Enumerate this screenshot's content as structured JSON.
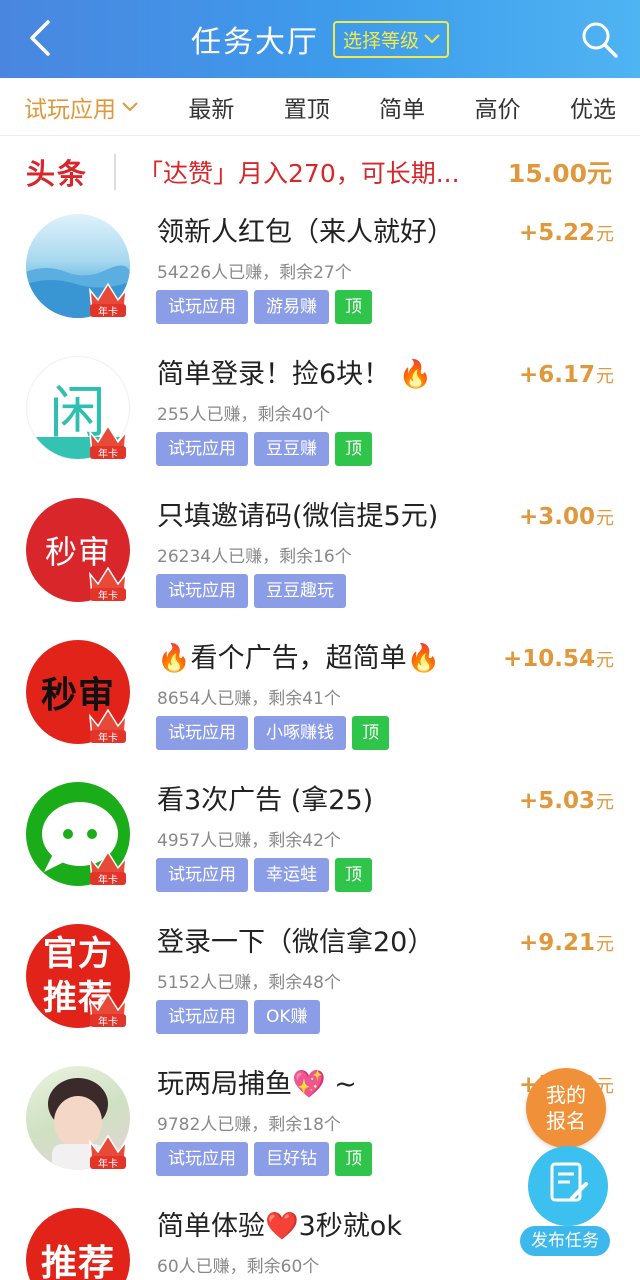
{
  "header": {
    "title": "任务大厅",
    "level_button": "选择等级",
    "back_icon": "chevron-left-icon",
    "search_icon": "search-icon"
  },
  "tabs": [
    {
      "label": "试玩应用",
      "active": true
    },
    {
      "label": "最新"
    },
    {
      "label": "置顶"
    },
    {
      "label": "简单"
    },
    {
      "label": "高价"
    },
    {
      "label": "优选"
    }
  ],
  "headline": {
    "tag": "头条",
    "text": "「达赞」月入270，可长期...",
    "price": "15.00元"
  },
  "tasks": [
    {
      "title": "领新人红包（来人就好）",
      "meta": "54226人已赚，剩余27个",
      "tags": [
        "试玩应用",
        "游易赚"
      ],
      "top": "顶",
      "price": "+5.22",
      "unit": "元",
      "badge": "年卡",
      "avatar_color": "#7fc4e6"
    },
    {
      "title": "简单登录！捡6块！ 🔥",
      "meta": "255人已赚，剩余40个",
      "tags": [
        "试玩应用",
        "豆豆赚"
      ],
      "top": "顶",
      "price": "+6.17",
      "unit": "元",
      "badge": "年卡",
      "avatar_text": "闲",
      "avatar_color": "#ffffff"
    },
    {
      "title": "只填邀请码(微信提5元)",
      "meta": "26234人已赚，剩余16个",
      "tags": [
        "试玩应用",
        "豆豆趣玩"
      ],
      "top": "",
      "price": "+3.00",
      "unit": "元",
      "badge": "年卡",
      "avatar_text": "秒审",
      "avatar_color": "#d8262b"
    },
    {
      "title": "🔥看个广告，超简单🔥",
      "meta": "8654人已赚，剩余41个",
      "tags": [
        "试玩应用",
        "小啄赚钱"
      ],
      "top": "顶",
      "price": "+10.54",
      "unit": "元",
      "badge": "年卡",
      "avatar_text": "秒审",
      "avatar_color": "#e2231a"
    },
    {
      "title": "看3次广告 (拿25)",
      "meta": "4957人已赚，剩余42个",
      "tags": [
        "试玩应用",
        "幸运蛙"
      ],
      "top": "顶",
      "price": "+5.03",
      "unit": "元",
      "badge": "年卡",
      "avatar_color": "#1aad19"
    },
    {
      "title": "登录一下（微信拿20）",
      "meta": "5152人已赚，剩余48个",
      "tags": [
        "试玩应用",
        "OK赚"
      ],
      "top": "",
      "price": "+9.21",
      "unit": "元",
      "badge": "年卡",
      "avatar_text": "官方推荐",
      "avatar_color": "#e2231a"
    },
    {
      "title": "玩两局捕鱼💖 ~",
      "meta": "9782人已赚，剩余18个",
      "tags": [
        "试玩应用",
        "巨好钻"
      ],
      "top": "顶",
      "price": "+5.00",
      "unit": "元",
      "badge": "年卡",
      "avatar_color": "#d9e8d0"
    },
    {
      "title": "简单体验❤️3秒就ok",
      "meta": "60人已赚，剩余60个",
      "tags": [],
      "top": "",
      "price": "",
      "unit": "",
      "badge": "",
      "avatar_text": "推荐",
      "avatar_color": "#e2231a"
    }
  ],
  "fab": {
    "signup_line1": "我的",
    "signup_line2": "报名",
    "publish_label": "发布任务"
  },
  "colors": {
    "header_start": "#4a86e0",
    "header_end": "#4fb4f2",
    "accent_orange": "#e0983c",
    "headline_red": "#d9262b",
    "tag_blue": "#8c9de8",
    "tag_green": "#2fc44a"
  }
}
